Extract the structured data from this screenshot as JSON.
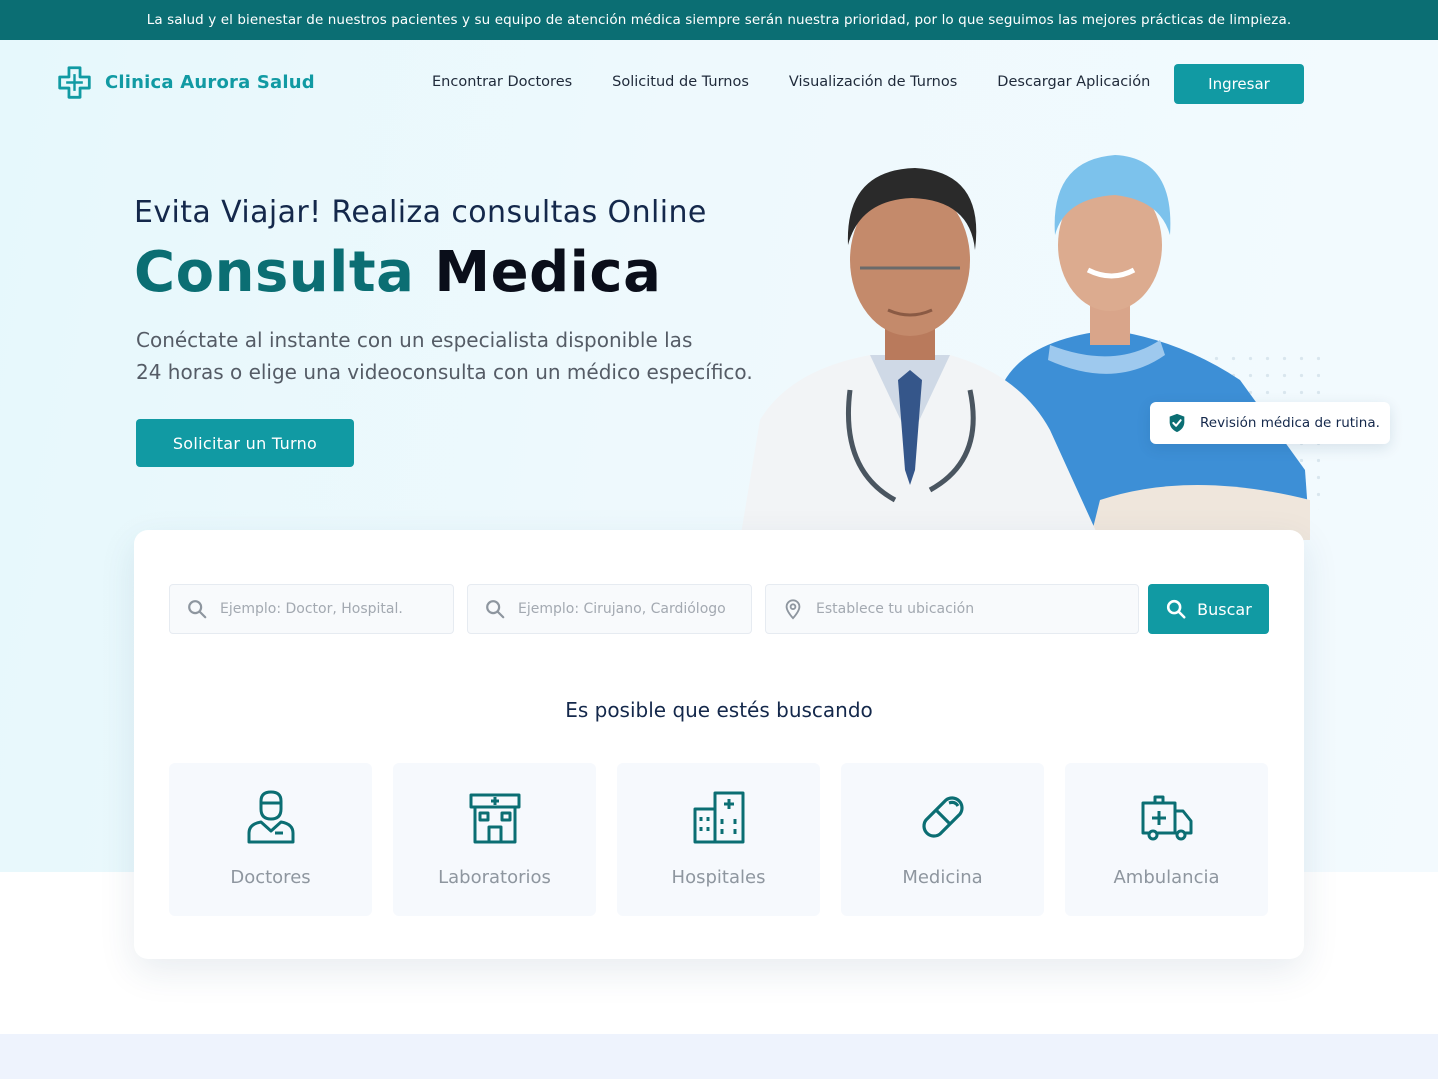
{
  "announcement": "La salud y el bienestar de nuestros pacientes y su equipo de atención médica siempre serán nuestra prioridad, por lo que seguimos las mejores prácticas de limpieza.",
  "brand": {
    "name": "Clinica Aurora Salud",
    "color": "#119aa3",
    "dark": "#0b6e73"
  },
  "nav": {
    "items": [
      "Encontrar Doctores",
      "Solicitud de Turnos",
      "Visualización de Turnos",
      "Descargar Aplicación"
    ],
    "login_label": "Ingresar"
  },
  "hero": {
    "eyebrow": "Evita Viajar! Realiza consultas Online",
    "headline_part1": "Consulta",
    "headline_part2": "Medica",
    "description_line1": "Conéctate al instante con un especialista disponible las",
    "description_line2": "24 horas o elige una videoconsulta con un médico específico.",
    "cta_label": "Solicitar un Turno",
    "badge_text": "Revisión médica de rutina.",
    "badge_icon": "shield-check-icon"
  },
  "search": {
    "field1_placeholder": "Ejemplo: Doctor, Hospital.",
    "field2_placeholder": "Ejemplo: Cirujano, Cardiólogo",
    "field3_placeholder": "Establece tu ubicación",
    "button_label": "Buscar",
    "suggest_title": "Es posible que estés buscando",
    "categories": [
      {
        "label": "Doctores",
        "icon": "doctor-icon"
      },
      {
        "label": "Laboratorios",
        "icon": "laboratory-icon"
      },
      {
        "label": "Hospitales",
        "icon": "hospital-icon"
      },
      {
        "label": "Medicina",
        "icon": "pill-icon"
      },
      {
        "label": "Ambulancia",
        "icon": "ambulance-icon"
      }
    ]
  }
}
